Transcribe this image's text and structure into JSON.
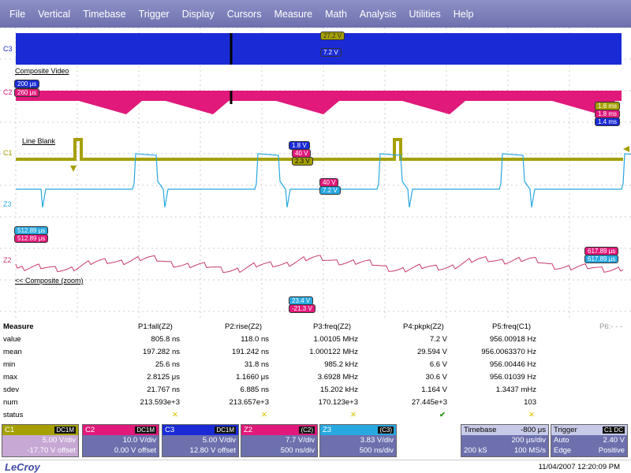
{
  "menu": [
    "File",
    "Vertical",
    "Timebase",
    "Trigger",
    "Display",
    "Cursors",
    "Measure",
    "Math",
    "Analysis",
    "Utilities",
    "Help"
  ],
  "traces": {
    "c3": {
      "name": "C3",
      "tag_top": "27.2 V",
      "tag_bottom": "7.2 V"
    },
    "c2": {
      "name": "C2",
      "label": "Composite Video",
      "tag1": "200 μs",
      "tag2": "260 μs",
      "right1": "1.8 ms",
      "right2": "1.8 ms",
      "right3": "1.4 ms"
    },
    "c1": {
      "name": "C1",
      "label": "Line Blank",
      "tag1": "1.8 V",
      "tag2": "40 V",
      "tag3": "2.3 V"
    },
    "z3": {
      "name": "Z3",
      "tag1": "40 V",
      "tag2": "7.2 V",
      "left1": "512.89 μs",
      "left2": "512.89 μs"
    },
    "z2": {
      "name": "Z2",
      "label": "<< Composite (zoom)",
      "right1": "617.89 μs",
      "right2": "617.89 μs",
      "bot1": "23.4 V",
      "bot2": "-21.3 V"
    }
  },
  "measure": {
    "title": "Measure",
    "params": [
      "P1:fall(Z2)",
      "P2:rise(Z2)",
      "P3:freq(Z2)",
      "P4:pkpk(Z2)",
      "P5:freq(C1)",
      "P6:- - -"
    ],
    "rows": [
      {
        "label": "value",
        "vals": [
          "805.8 ns",
          "118.0 ns",
          "1.00105 MHz",
          "7.2 V",
          "956.00918 Hz"
        ]
      },
      {
        "label": "mean",
        "vals": [
          "197.282 ns",
          "191.242 ns",
          "1.000122 MHz",
          "29.594 V",
          "956.0063370 Hz"
        ]
      },
      {
        "label": "min",
        "vals": [
          "25.6 ns",
          "31.8 ns",
          "985.2 kHz",
          "6.6 V",
          "956.00446 Hz"
        ]
      },
      {
        "label": "max",
        "vals": [
          "2.8125 μs",
          "1.1660 μs",
          "3.6928 MHz",
          "30.6 V",
          "956.01039 Hz"
        ]
      },
      {
        "label": "sdev",
        "vals": [
          "21.767 ns",
          "6.885 ns",
          "15.202 kHz",
          "1.164 V",
          "1.3437 mHz"
        ]
      },
      {
        "label": "num",
        "vals": [
          "213.593e+3",
          "213.657e+3",
          "170.123e+3",
          "27.445e+3",
          "103"
        ]
      }
    ],
    "status_label": "status",
    "status": [
      "✕",
      "✕",
      "✕",
      "✔",
      "✕"
    ]
  },
  "channels": [
    {
      "name": "C1",
      "coupling": "DC1M",
      "l1": "5.00 V/div",
      "l2": "-17.70 V offset",
      "color": "#c7a8d4",
      "head": "#a5a000"
    },
    {
      "name": "C2",
      "coupling": "DC1M",
      "l1": "10.0 V/div",
      "l2": "0.00 V offset",
      "color": "#6d70ad",
      "head": "#e0197a"
    },
    {
      "name": "C3",
      "coupling": "DC1M",
      "l1": "5.00 V/div",
      "l2": "12.80 V offset",
      "color": "#6d70ad",
      "head": "#1a2bd6"
    },
    {
      "name": "Z2",
      "coupling": "(C2)",
      "l1": "7.7 V/div",
      "l2": "500 ns/div",
      "color": "#6d70ad",
      "head": "#e0197a"
    },
    {
      "name": "Z3",
      "coupling": "(C3)",
      "l1": "3.83 V/div",
      "l2": "500 ns/div",
      "color": "#6d70ad",
      "head": "#28a8e0"
    }
  ],
  "timebase": {
    "label": "Timebase",
    "offset": "-800 μs",
    "div": "200 μs/div",
    "samples": "200 kS",
    "rate": "100 MS/s"
  },
  "trigger": {
    "label": "Trigger",
    "src": "C1 DC",
    "mode": "Auto",
    "level": "2.40 V",
    "edge_label": "Edge",
    "slope": "Positive"
  },
  "footer": {
    "brand": "LeCroy",
    "datetime": "11/04/2007 12:20:09 PM"
  },
  "colors": {
    "c1": "#a5a000",
    "c2": "#e0197a",
    "c3": "#1a2bd6",
    "z3": "#28a8e0",
    "z2": "#c8386e",
    "menu": "#7a7db8"
  }
}
